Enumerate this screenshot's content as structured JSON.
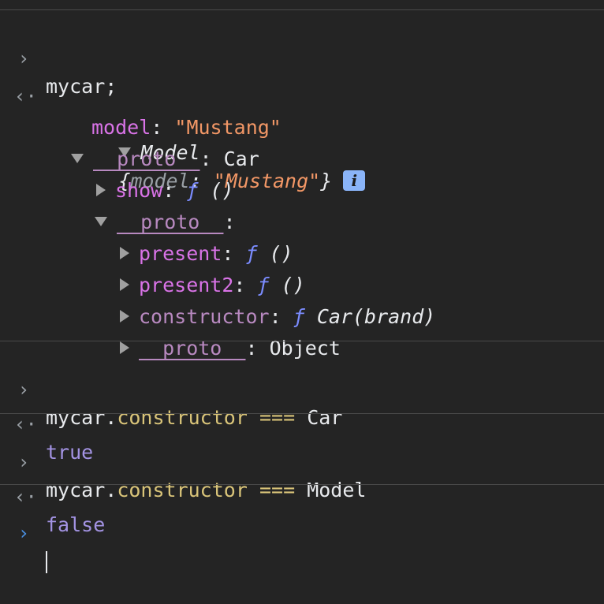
{
  "glyphs": {
    "input": "›",
    "output": "‹·",
    "prompt": "›"
  },
  "entries": {
    "e1": {
      "input": "mycar;"
    },
    "obj": {
      "class_name": "Model",
      "preview_open": "{",
      "preview_key": "model",
      "preview_colon": ": ",
      "preview_value": "\"Mustang\"",
      "preview_close": "}",
      "info_label": "i",
      "model_key": "model",
      "model_value": "\"Mustang\"",
      "proto1_key": "__proto__",
      "proto1_value": "Car",
      "show_key": "show",
      "f": "ƒ",
      "parens": "()",
      "proto2_key": "__proto__",
      "present_key": "present",
      "present2_key": "present2",
      "constructor_key": "constructor",
      "constructor_value": "Car(brand)",
      "proto3_key": "__proto__",
      "proto3_value": "Object",
      "colon": ":"
    },
    "e2": {
      "object": "mycar",
      "dot": ".",
      "prop": "constructor",
      "op": "===",
      "rhs": "Car",
      "result": "true"
    },
    "e3": {
      "object": "mycar",
      "dot": ".",
      "prop": "constructor",
      "op": "===",
      "rhs": "Model",
      "result": "false"
    }
  },
  "colors": {
    "background": "#242424",
    "property": "#d973e7",
    "string": "#f29766",
    "function": "#7b8cff",
    "keyword": "#d9c479",
    "boolean": "#a393e3",
    "prompt_active": "#4a90e2"
  }
}
